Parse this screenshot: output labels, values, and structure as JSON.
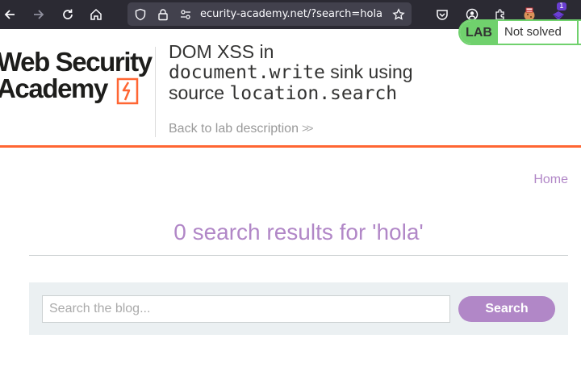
{
  "browser": {
    "url": "ecurity-academy.net/?search=hola",
    "extension_badge": "1",
    "icons": [
      "back-arrow-icon",
      "forward-arrow-icon",
      "reload-icon",
      "home-icon",
      "shield-icon",
      "lock-icon",
      "permissions-icon",
      "bookmark-star-icon",
      "pocket-icon",
      "account-icon",
      "extensions-icon",
      "cookie-extension-icon",
      "hackbar-extension-icon"
    ]
  },
  "lab": {
    "logo_line1": "Web Security",
    "logo_line2": "Academy",
    "title_prefix": "DOM XSS in",
    "title_code1": "document.write",
    "title_mid": "sink using",
    "title_source": "source",
    "title_code2": "location.search",
    "back_link": "Back to lab description",
    "status_badge": "LAB",
    "status_text": "Not solved"
  },
  "nav": {
    "home": "Home"
  },
  "results": {
    "heading": "0 search results for 'hola'"
  },
  "search": {
    "placeholder": "Search the blog...",
    "button": "Search"
  },
  "colors": {
    "accent": "#b187c7",
    "orange": "#ff6633",
    "lab_green": "#70d16d"
  }
}
